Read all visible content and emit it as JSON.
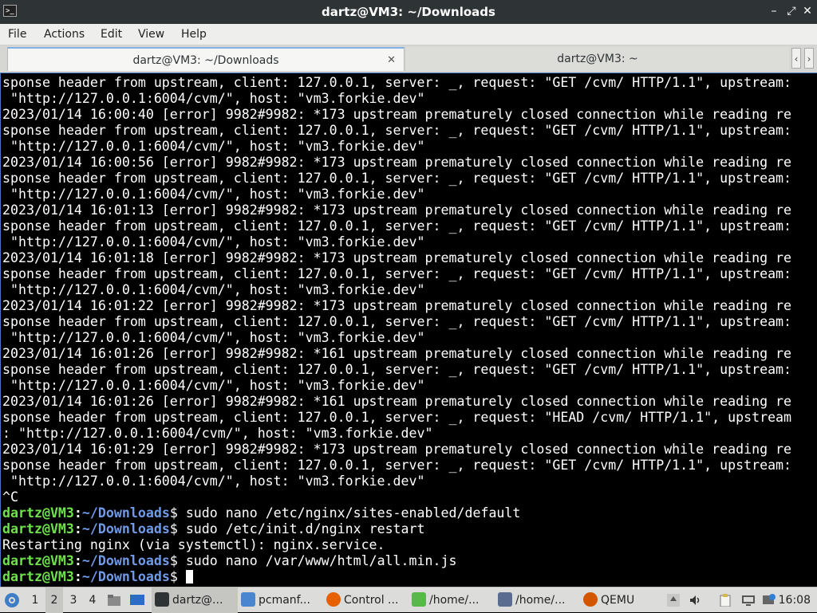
{
  "window": {
    "title": "dartz@VM3: ~/Downloads",
    "app_icon": ">_",
    "minimize": "–",
    "maximize": "⤢",
    "close": "✕"
  },
  "menu": {
    "items": [
      "File",
      "Actions",
      "Edit",
      "View",
      "Help"
    ]
  },
  "tabs": [
    {
      "label": "dartz@VM3: ~/Downloads",
      "active": true,
      "close": "✕"
    },
    {
      "label": "dartz@VM3: ~",
      "active": false
    }
  ],
  "tab_scroll": {
    "left": "‹",
    "right": "›"
  },
  "terminal": {
    "log_lines": [
      "sponse header from upstream, client: 127.0.0.1, server: _, request: \"GET /cvm/ HTTP/1.1\", upstream:",
      " \"http://127.0.0.1:6004/cvm/\", host: \"vm3.forkie.dev\"",
      "2023/01/14 16:00:40 [error] 9982#9982: *173 upstream prematurely closed connection while reading re",
      "sponse header from upstream, client: 127.0.0.1, server: _, request: \"GET /cvm/ HTTP/1.1\", upstream:",
      " \"http://127.0.0.1:6004/cvm/\", host: \"vm3.forkie.dev\"",
      "2023/01/14 16:00:56 [error] 9982#9982: *173 upstream prematurely closed connection while reading re",
      "sponse header from upstream, client: 127.0.0.1, server: _, request: \"GET /cvm/ HTTP/1.1\", upstream:",
      " \"http://127.0.0.1:6004/cvm/\", host: \"vm3.forkie.dev\"",
      "2023/01/14 16:01:13 [error] 9982#9982: *173 upstream prematurely closed connection while reading re",
      "sponse header from upstream, client: 127.0.0.1, server: _, request: \"GET /cvm/ HTTP/1.1\", upstream:",
      " \"http://127.0.0.1:6004/cvm/\", host: \"vm3.forkie.dev\"",
      "2023/01/14 16:01:18 [error] 9982#9982: *173 upstream prematurely closed connection while reading re",
      "sponse header from upstream, client: 127.0.0.1, server: _, request: \"GET /cvm/ HTTP/1.1\", upstream:",
      " \"http://127.0.0.1:6004/cvm/\", host: \"vm3.forkie.dev\"",
      "2023/01/14 16:01:22 [error] 9982#9982: *173 upstream prematurely closed connection while reading re",
      "sponse header from upstream, client: 127.0.0.1, server: _, request: \"GET /cvm/ HTTP/1.1\", upstream:",
      " \"http://127.0.0.1:6004/cvm/\", host: \"vm3.forkie.dev\"",
      "2023/01/14 16:01:26 [error] 9982#9982: *161 upstream prematurely closed connection while reading re",
      "sponse header from upstream, client: 127.0.0.1, server: _, request: \"GET /cvm/ HTTP/1.1\", upstream:",
      " \"http://127.0.0.1:6004/cvm/\", host: \"vm3.forkie.dev\"",
      "2023/01/14 16:01:26 [error] 9982#9982: *161 upstream prematurely closed connection while reading re",
      "sponse header from upstream, client: 127.0.0.1, server: _, request: \"HEAD /cvm/ HTTP/1.1\", upstream",
      ": \"http://127.0.0.1:6004/cvm/\", host: \"vm3.forkie.dev\"",
      "2023/01/14 16:01:29 [error] 9982#9982: *173 upstream prematurely closed connection while reading re",
      "sponse header from upstream, client: 127.0.0.1, server: _, request: \"GET /cvm/ HTTP/1.1\", upstream:",
      " \"http://127.0.0.1:6004/cvm/\", host: \"vm3.forkie.dev\"",
      "^C"
    ],
    "prompt": {
      "user": "dartz@VM3",
      "colon": ":",
      "path": "~/Downloads",
      "symbol": "$ "
    },
    "commands": [
      {
        "type": "prompt",
        "text": "sudo nano /etc/nginx/sites-enabled/default"
      },
      {
        "type": "prompt",
        "text": "sudo /etc/init.d/nginx restart"
      },
      {
        "type": "output",
        "text": "Restarting nginx (via systemctl): nginx.service."
      },
      {
        "type": "prompt",
        "text": "sudo nano /var/www/html/all.min.js"
      },
      {
        "type": "prompt",
        "text": "",
        "cursor": true
      }
    ]
  },
  "taskbar": {
    "workspaces": [
      "1",
      "2",
      "3",
      "4"
    ],
    "active_workspace": "2",
    "tasks": [
      {
        "label": "dartz@...",
        "icon": "terminal-icon",
        "color": "#2e3436",
        "active": true
      },
      {
        "label": "pcmanf...",
        "icon": "folder-icon",
        "color": "#4a86cf",
        "active": false
      },
      {
        "label": "Control ...",
        "icon": "firefox-icon",
        "color": "#e66000",
        "active": false
      },
      {
        "label": "/home/...",
        "icon": "editor-icon",
        "color": "#58b849",
        "active": false
      },
      {
        "label": "/home/...",
        "icon": "text-icon",
        "color": "#5a6c8f",
        "active": false
      },
      {
        "label": "QEMU",
        "icon": "qemu-icon",
        "color": "#d45500",
        "active": false
      }
    ],
    "clock": "16:08"
  },
  "colors": {
    "prompt_user": "#6ee24a",
    "prompt_path": "#6f9ae8",
    "titlebar": "#2e3436",
    "taskbar": "#dcdcda"
  }
}
